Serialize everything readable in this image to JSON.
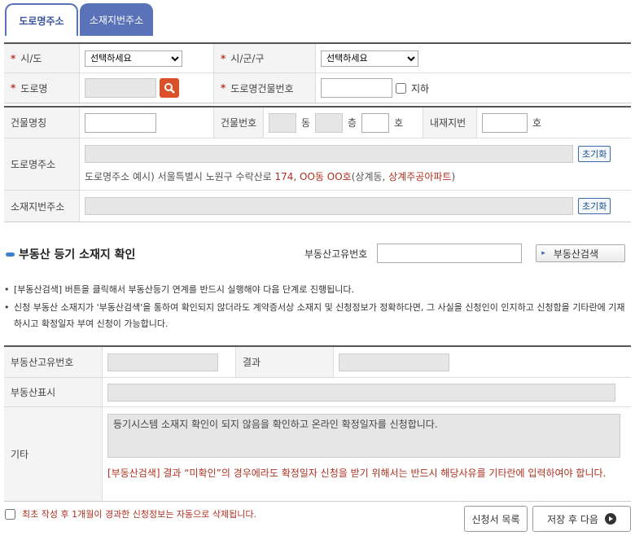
{
  "tabs": {
    "road": "도로명주소",
    "lot": "소재지번주소"
  },
  "address": {
    "sido_label": "시/도",
    "sido_value": "선택하세요",
    "sigungu_label": "시/군/구",
    "sigungu_value": "선택하세요",
    "road_label": "도로명",
    "bldg_no_label": "도로명건물번호",
    "underground_label": "지하"
  },
  "building": {
    "name_label": "건물명칭",
    "no_label": "건물번호",
    "dong": "동",
    "floor": "층",
    "ho": "호",
    "inner_label": "내재지번",
    "inner_ho": "호",
    "road_addr_label": "도로명주소",
    "reset": "초기화",
    "example_prefix": "도로명주소 예시) 서울특별시 노원구 수락산로 ",
    "example_highlight": "174, OO동 OO호",
    "example_mid": "(상계동, ",
    "example_highlight2": "상계주공아파트",
    "example_suffix": ")",
    "lot_addr_label": "소재지번주소",
    "reset2": "초기화"
  },
  "registry": {
    "title": "부동산 등기 소재지 확인",
    "uid_label": "부동산고유번호",
    "search_button": "부동산검색"
  },
  "notes": [
    "[부동산검색] 버튼을 클릭해서 부동산등기 연계를 반드시 실행해야 다음 단계로 진행됩니다.",
    "신청 부동산 소재지가 '부동산검색'을 통하여 확인되지 않더라도 계약증서상 소재지 및 신청정보가 정확하다면, 그 사실을 신청인이 인지하고 신청함을 기타란에 기재하시고 확정일자 부여 신청이 가능합니다."
  ],
  "result": {
    "uid_label": "부동산고유번호",
    "result_label": "결과",
    "display_label": "부동산표시",
    "etc_label": "기타",
    "etc_value": "등기시스템 소재지 확인이 되지 않음을 확인하고 온라인 확정일자를 신청합니다.",
    "warning": "[부동산검색] 결과 “미확인”의 경우에라도 확정일자 신청을 받기 위해서는 반드시 해당사유를 기타란에 입력하여야 합니다."
  },
  "footer": {
    "notice": "최초 작성 후 1개월이 경과한 신청정보는 자동으로 삭제됩니다.",
    "list_button": "신청서 목록",
    "save_button": "저장 후 다음"
  },
  "colors": {
    "accent": "#5a72b8",
    "warning": "#b03020",
    "search": "#d9502b"
  }
}
